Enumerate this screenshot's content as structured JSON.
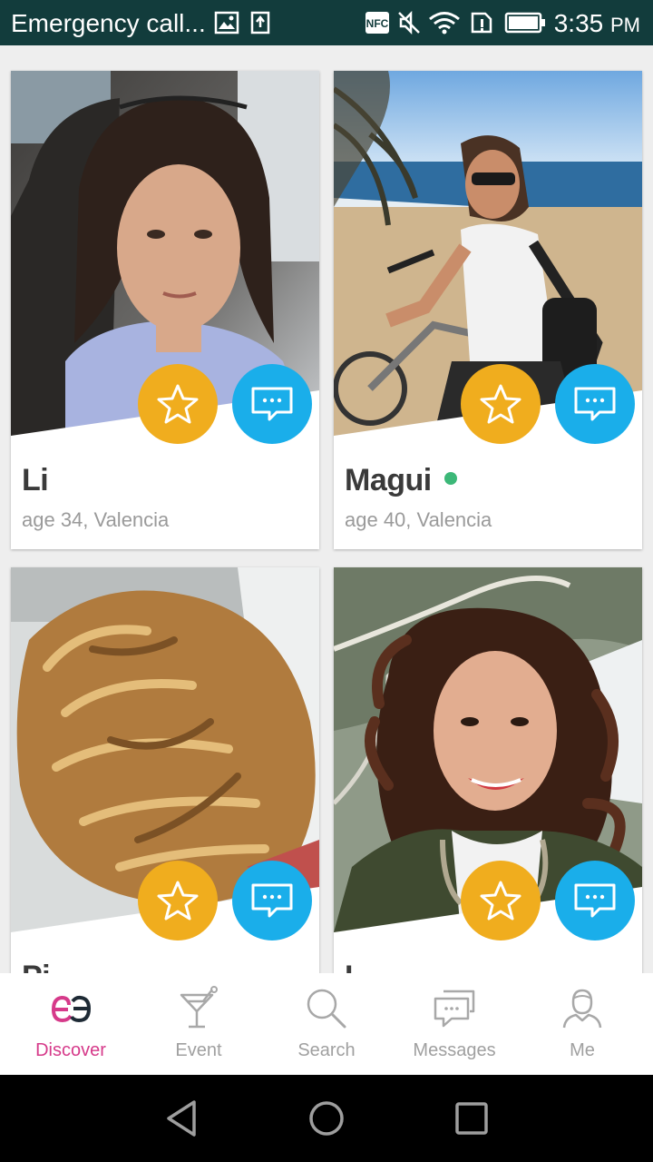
{
  "status_bar": {
    "title": "Emergency call...",
    "time": "3:35",
    "ampm": "PM"
  },
  "profiles": [
    {
      "name": "Li",
      "age": "age 34,",
      "city": "Valencia",
      "online": false
    },
    {
      "name": "Magui",
      "age": "age 40,",
      "city": "Valencia",
      "online": true
    },
    {
      "name": "Pi",
      "age": "",
      "city": "",
      "online": false
    },
    {
      "name": "L",
      "age": "",
      "city": "",
      "online": false
    }
  ],
  "tabs": [
    {
      "label": "Discover",
      "icon": "discover-logo-icon",
      "active": true
    },
    {
      "label": "Event",
      "icon": "cocktail-glass-icon",
      "active": false
    },
    {
      "label": "Search",
      "icon": "search-icon",
      "active": false
    },
    {
      "label": "Messages",
      "icon": "messages-icon",
      "active": false
    },
    {
      "label": "Me",
      "icon": "person-icon",
      "active": false
    }
  ],
  "colors": {
    "status_bar": "#123c3c",
    "star_button": "#f0ad1e",
    "chat_button": "#1aaeea",
    "active_tab": "#d63a8a",
    "online_dot": "#3cb878"
  },
  "icons": {
    "star": "star-outline-icon",
    "chat": "chat-bubble-icon",
    "nav_back": "back-triangle-icon",
    "nav_home": "home-circle-icon",
    "nav_recents": "recents-square-icon"
  }
}
